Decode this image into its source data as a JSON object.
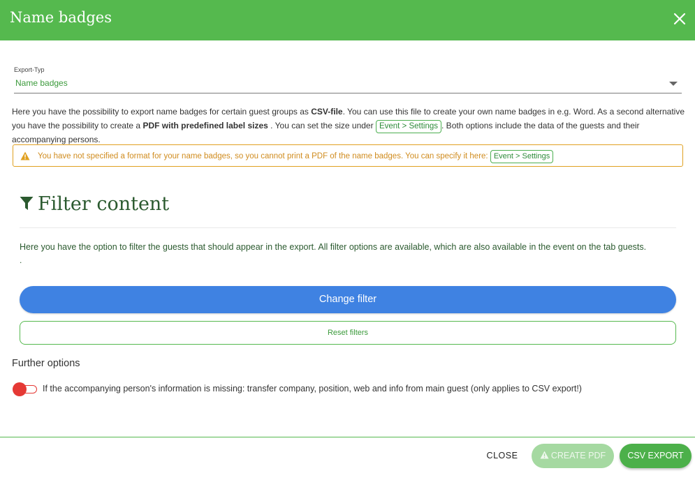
{
  "dialog": {
    "title": "Name badges",
    "close_icon": "close-icon"
  },
  "export_type": {
    "label": "Export-Typ",
    "value": "Name badges"
  },
  "info": {
    "part1": "Here you have the possibility to export name badges for certain guest groups as ",
    "csv_bold": "CSV-file",
    "part2": ". You can use this file to create your own name badges in e.g. Word. As a second alternative you have the possibility to create a ",
    "pdf_bold": "PDF with predefined label sizes",
    "part3": " . You can set the size under ",
    "link": "Event > Settings",
    "part4": ". Both options include the data of the guests and their accompanying persons."
  },
  "warning": {
    "text": "You have not specified a format for your name badges, so you cannot print a PDF of the name badges. You can specify it here:",
    "link": "Event > Settings"
  },
  "filter": {
    "title": "Filter content",
    "description": "Here you have the option to filter the guests that should appear in the export. All filter options are available, which are also available in the event on the tab guests.",
    "dot": ".",
    "change_button": "Change filter",
    "reset_button": "Reset filters"
  },
  "further": {
    "title": "Further options",
    "toggle_label": "If the accompanying person's information is missing: transfer company, position, web and info from main guest (only applies to CSV export!)",
    "toggle_on": false
  },
  "footer": {
    "close": "CLOSE",
    "create_pdf": "CREATE PDF",
    "csv_export": "CSV EXPORT"
  },
  "colors": {
    "header": "#55b94e",
    "primary_blue": "#3f82e2",
    "warning": "#e0a020",
    "toggle_off": "#e53935"
  }
}
